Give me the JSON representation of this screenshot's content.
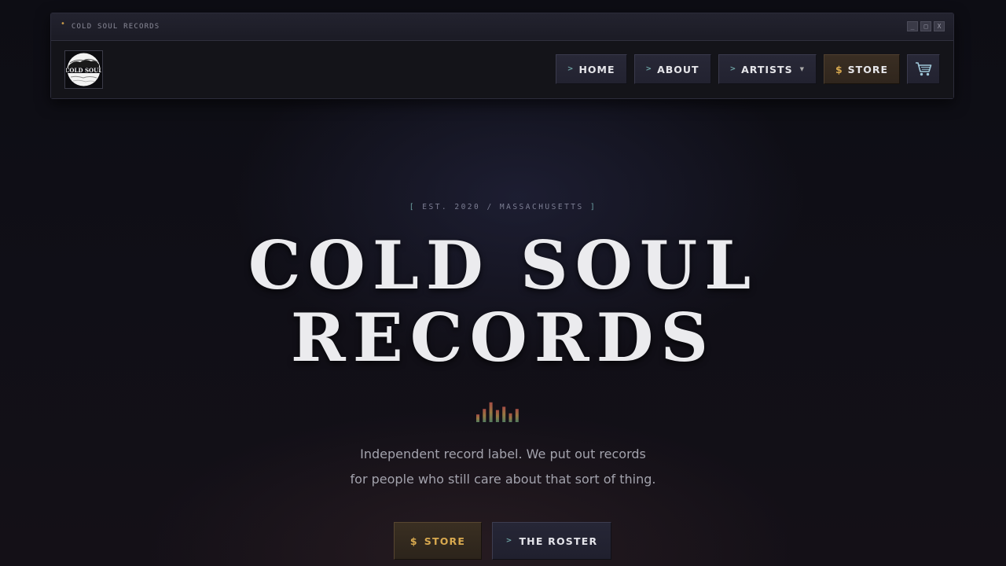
{
  "window": {
    "title": "COLD SOUL RECORDS",
    "controls": [
      "_",
      "□",
      "X"
    ]
  },
  "logo": {
    "text": "COLD SOUL"
  },
  "nav": {
    "items": [
      {
        "prefix": ">",
        "label": "HOME"
      },
      {
        "prefix": ">",
        "label": "ABOUT"
      },
      {
        "prefix": ">",
        "label": "ARTISTS",
        "has_dropdown": true
      },
      {
        "prefix": "$",
        "label": "STORE"
      }
    ],
    "cart_icon": "cart-icon"
  },
  "hero": {
    "est_prefix": "[",
    "est_text": "EST. 2020 / MASSACHUSETTS",
    "est_suffix": "]",
    "title_line1": "COLD SOUL",
    "title_line2": "RECORDS",
    "tagline_line1": "Independent record label. We put out records",
    "tagline_line2": "for people who still care about that sort of thing.",
    "cta_store_prefix": "$",
    "cta_store_label": "STORE",
    "cta_roster_prefix": ">",
    "cta_roster_label": "THE ROSTER"
  },
  "equalizer": {
    "icon": "equalizer-icon",
    "levels": [
      0.35,
      0.6,
      0.9,
      0.55,
      0.7,
      0.4,
      0.6
    ]
  },
  "colors": {
    "accent_teal": "#6fa5a6",
    "accent_gold": "#d8a94f",
    "background": "#0d0d14"
  }
}
